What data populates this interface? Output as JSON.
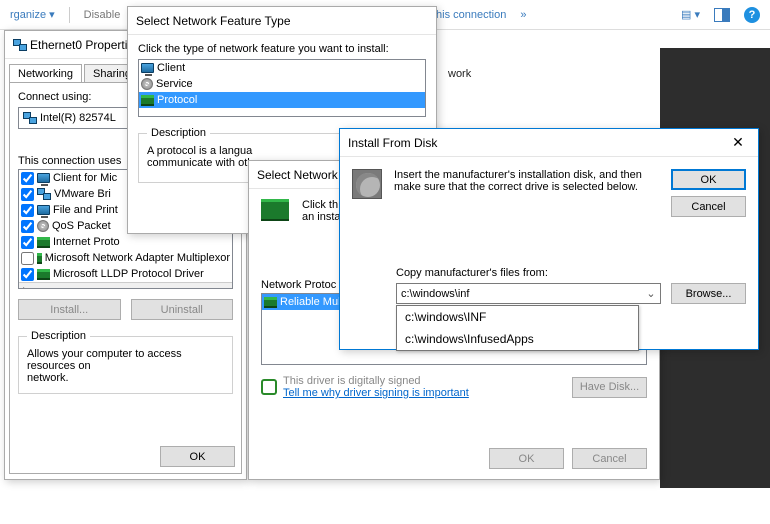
{
  "explorer": {
    "organize": "rganize ▾",
    "disable": "Disable",
    "rename": "Rename this connection",
    "more": "»",
    "network_label": "work"
  },
  "ethernet": {
    "title": "Ethernet0 Properti",
    "tabs": {
      "networking": "Networking",
      "sharing": "Sharing"
    },
    "connect_using": "Connect using:",
    "adapter": "Intel(R) 82574L",
    "uses_label": "This connection uses",
    "items": [
      "Client for Mic",
      "VMware Bri",
      "File and Print",
      "QoS Packet",
      "Internet Proto",
      "Microsoft Network Adapter Multiplexor",
      "Microsoft LLDP Protocol Driver"
    ],
    "item5_checked": false,
    "install": "Install...",
    "uninstall": "Uninstall",
    "desc_group": "Description",
    "desc_text": "Allows your computer to access resources on\nnetwork.",
    "ok": "OK"
  },
  "feature": {
    "title": "Select Network Feature Type",
    "prompt": "Click the type of network feature you want to install:",
    "items": {
      "client": "Client",
      "service": "Service",
      "protocol": "Protocol"
    },
    "desc_group": "Description",
    "desc_text": "A protocol is a langua\ncommunicate with oth"
  },
  "selectproto": {
    "title_partial": "Select Network F",
    "instr1": "Click th",
    "instr2": "an insta",
    "group": "Network Protoc",
    "item": "Reliable Mul",
    "signed": "This driver is digitally signed",
    "signed_link": "Tell me why driver signing is important",
    "have_disk": "Have Disk...",
    "ok": "OK",
    "cancel": "Cancel"
  },
  "disk": {
    "title": "Install From Disk",
    "msg1": "Insert the manufacturer's installation disk, and then",
    "msg2": "make sure that the correct drive is selected below.",
    "ok": "OK",
    "cancel": "Cancel",
    "copy_label": "Copy manufacturer's files from:",
    "value": "c:\\windows\\inf",
    "browse": "Browse...",
    "options": [
      "c:\\windows\\INF",
      "c:\\windows\\InfusedApps"
    ]
  }
}
